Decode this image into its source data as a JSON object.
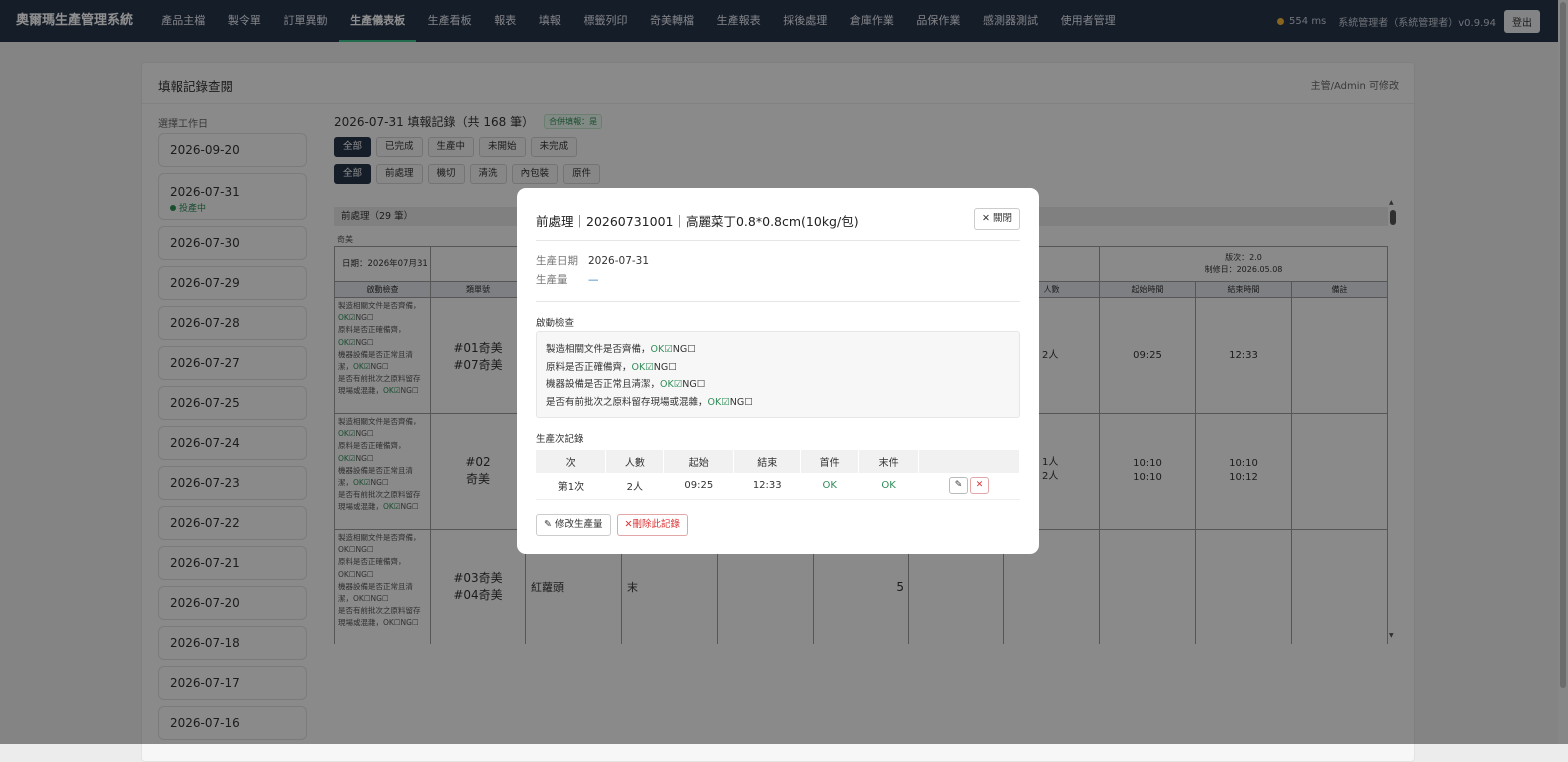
{
  "app": {
    "brand": "奧爾瑪生產管理系統",
    "nav": [
      "產品主檔",
      "製令單",
      "訂單異動",
      "生產儀表板",
      "生產看板",
      "報表",
      "填報",
      "標籤列印",
      "奇美轉檔",
      "生產報表",
      "採後處理",
      "倉庫作業",
      "品保作業",
      "感測器測試",
      "使用者管理"
    ],
    "active_nav_index": 3,
    "latency": "554 ms",
    "user": "系統管理者（系統管理者）v0.9.94",
    "logout": "登出"
  },
  "panel": {
    "title": "填報記錄查閱",
    "note": "主管/Admin 可修改",
    "date_label": "選擇工作日",
    "dates": [
      {
        "date": "2026-09-20"
      },
      {
        "date": "2026-07-31",
        "sub": "投產中"
      },
      {
        "date": "2026-07-30"
      },
      {
        "date": "2026-07-29"
      },
      {
        "date": "2026-07-28"
      },
      {
        "date": "2026-07-27"
      },
      {
        "date": "2026-07-25"
      },
      {
        "date": "2026-07-24"
      },
      {
        "date": "2026-07-23"
      },
      {
        "date": "2026-07-22"
      },
      {
        "date": "2026-07-21"
      },
      {
        "date": "2026-07-20"
      },
      {
        "date": "2026-07-18"
      },
      {
        "date": "2026-07-17"
      },
      {
        "date": "2026-07-16"
      }
    ],
    "records_header": "2026-07-31 填報記錄（共 168 筆）",
    "merge_badge": "合併填報：是",
    "status_filters": [
      "全部",
      "已完成",
      "生產中",
      "未開始",
      "未完成"
    ],
    "process_filters": [
      "全部",
      "前處理",
      "機切",
      "清洗",
      "內包裝",
      "原件"
    ],
    "section": "前處理（29 筆）",
    "sheet": {
      "customer": "奇美",
      "date": "日期：2026年07月31日",
      "version_line1": "版次：2.0",
      "version_line2": "制修日：2026.05.08",
      "headers": {
        "check": "啟動檢查",
        "lot": "類單號",
        "people": "人數",
        "start": "起始時間",
        "end": "結束時間",
        "remark": "備註"
      },
      "row1": {
        "lot1": "#01奇美",
        "lot2": "#07奇美",
        "people": "2人",
        "start": "09:25",
        "end": "12:33"
      },
      "row2": {
        "lot1": "#02",
        "lot2": "奇美",
        "people1": "1人",
        "people2": "2人",
        "start1": "10:10",
        "start2": "10:10",
        "end1": "10:10",
        "end2": "10:12"
      },
      "row3": {
        "lot1": "#03奇美",
        "lot2": "#04奇美",
        "item": "紅蘿頭",
        "cut": "末",
        "qty": "5"
      }
    }
  },
  "modal": {
    "title": "前處理｜20260731001｜高麗菜丁0.8*0.8cm(10kg/包)",
    "close": "關閉",
    "date_label": "生產日期",
    "date_value": "2026-07-31",
    "qty_label": "生產量",
    "qty_value": "—",
    "check_title": "啟動檢查",
    "checks": [
      {
        "q": "製造相關文件是否齊備，",
        "ok": "OK☑",
        "ng": "NG☐"
      },
      {
        "q": "原料是否正確備齊，",
        "ok": "OK☑",
        "ng": "NG☐"
      },
      {
        "q": "機器設備是否正常且清潔，",
        "ok": "OK☑",
        "ng": "NG☐"
      },
      {
        "q": "是否有前批次之原料留存現場或混雜，",
        "ok": "OK☑",
        "ng": "NG☐"
      }
    ],
    "batch_title": "生產次記錄",
    "batch_headers": [
      "次",
      "人數",
      "起始",
      "結束",
      "首件",
      "末件"
    ],
    "batch_rows": [
      {
        "n": "第1次",
        "people": "2人",
        "start": "09:25",
        "end": "12:33",
        "first": "OK",
        "last": "OK"
      }
    ],
    "edit_qty": "修改生產量",
    "delete_record": "刪除此記錄"
  }
}
